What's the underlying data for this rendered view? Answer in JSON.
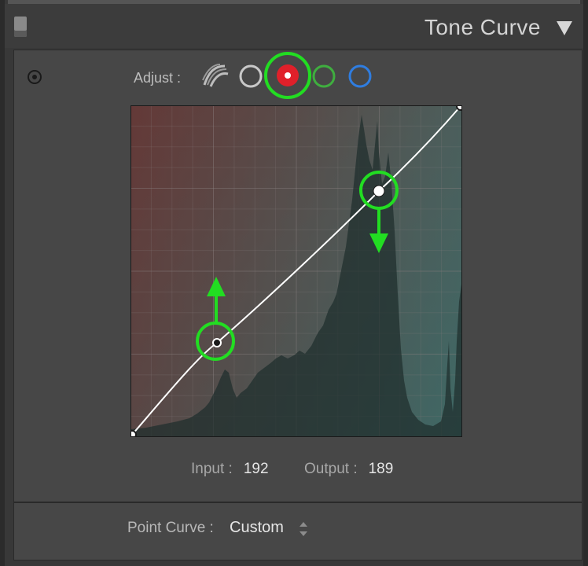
{
  "panel": {
    "title": "Tone Curve"
  },
  "adjust": {
    "label": "Adjust :",
    "channels": [
      "parametric",
      "rgb",
      "red",
      "green",
      "blue"
    ],
    "selected": "red"
  },
  "colors": {
    "highlight": "#22dd22",
    "red_channel": "#e0202a",
    "green_channel": "#3fae3f",
    "blue_channel": "#2f7de0",
    "curve": "#ffffff"
  },
  "readout": {
    "input_label": "Input :",
    "input_value": "192",
    "output_label": "Output :",
    "output_value": "189"
  },
  "footer": {
    "point_curve_label": "Point Curve :",
    "point_curve_value": "Custom"
  },
  "curve_points": [
    {
      "input": 0,
      "output": 0
    },
    {
      "input": 66,
      "output": 72
    },
    {
      "input": 192,
      "output": 189
    },
    {
      "input": 255,
      "output": 255
    }
  ],
  "annotations": [
    {
      "type": "arrow-up",
      "point": 1
    },
    {
      "type": "arrow-down",
      "point": 2
    }
  ]
}
